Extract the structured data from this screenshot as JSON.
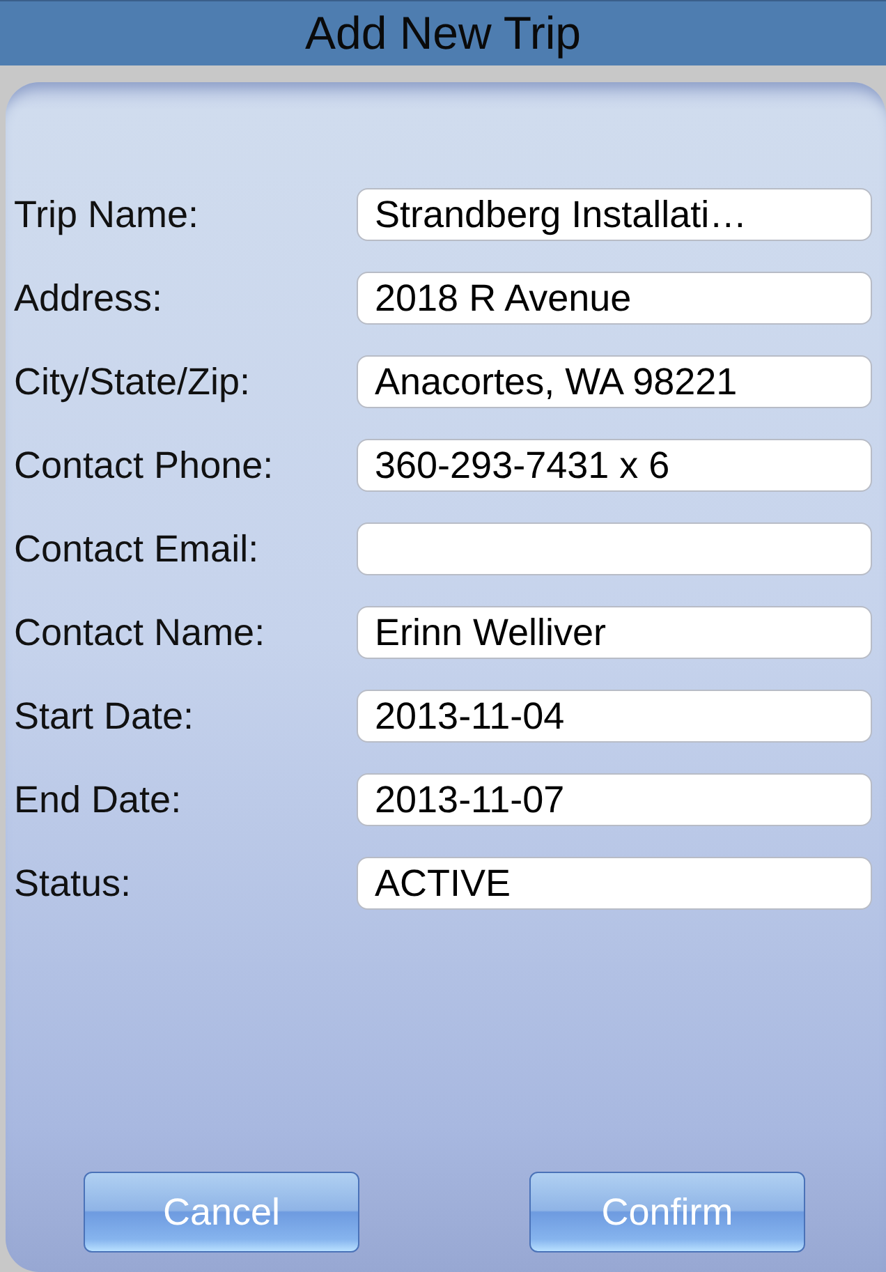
{
  "window": {
    "title": "Add New Trip"
  },
  "fields": [
    {
      "label": "Trip Name:",
      "value": "Strandberg Installati…"
    },
    {
      "label": "Address:",
      "value": "2018 R Avenue"
    },
    {
      "label": "City/State/Zip:",
      "value": "Anacortes, WA 98221"
    },
    {
      "label": "Contact Phone:",
      "value": "360-293-7431 x 6"
    },
    {
      "label": "Contact Email:"
    },
    {
      "label": "Contact Name:",
      "value": "Erinn Welliver"
    },
    {
      "label": "Start Date:",
      "value": "2013-11-04"
    },
    {
      "label": "End Date:",
      "value": "2013-11-07"
    },
    {
      "label": "Status:",
      "value": "ACTIVE"
    }
  ],
  "buttons": [
    "Cancel",
    "Confirm"
  ]
}
